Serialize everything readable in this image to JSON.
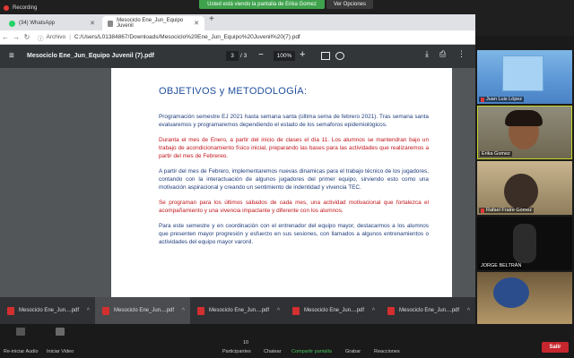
{
  "recording": {
    "label": "Recording"
  },
  "share_banner": {
    "text": "Usted está viendo la pantalla de Erika Gomez",
    "options": "Ver Opciones"
  },
  "browser": {
    "tabs": [
      {
        "label": "(34) WhatsApp",
        "active": false
      },
      {
        "label": "Mesociclo Ene_Jun_Equipo Juvenil",
        "active": true
      }
    ],
    "address": {
      "info": "Archivo",
      "url": "C:/Users/L01384867/Downloads/Mesociclo%20Ene_Jun_Equipo%20Juvenil%20(7).pdf"
    }
  },
  "pdf": {
    "title": "Mesociclo Ene_Jun_Equipo Juvenil (7).pdf",
    "page_current": "3",
    "page_total": "/ 3",
    "zoom": "100%",
    "heading": "OBJETIVOS y METODOLOGÍA:",
    "paragraphs": [
      {
        "text": "Programación semestre EJ 2021 hasta semana santa (última sema de febrero 2021). Tras semana santa evaluaremos y programaremos dependiendo el estado de los semaforos epidemiológicos.",
        "color": "blue"
      },
      {
        "text": "Duranta el mes de Enero, a partir del inicio de clases el día 11. Los alumnos se mantendran bajo un trabajo de acondicionamiento físico inicial, preparando las bases para las actividades que realizaremos a partir del mes de Febrereo.",
        "color": "red"
      },
      {
        "text": "A partir del mes de Febrero, implementaremos nuevas dinamicas para el trabajo técnico de los jugadores, contando con la interactuación de algunos jugadores del primer equipo, sirviendo esto como una motivación aspiracional y creando un sentimiento de indentidad y vivencia TEC.",
        "color": "blue"
      },
      {
        "text": "Se programan para los últimos sábados de cada mes, una actividad motivacional que fortalezca el acompañamiento y una vivencia impactante y diferente con los alumnos.",
        "color": "red"
      },
      {
        "text": "Para este semestre y en coordinación con el entrenador del equipo mayor, destacarmos a los alumnos que presenten mayor progresión y esfuerzo en sus sesiones, con llamados a algunos entrenamientos o actividades del equipo mayor varonil.",
        "color": "blue"
      }
    ]
  },
  "downloads": [
    {
      "label": "Mesociclo Ene_Jun....pdf",
      "highlighted": false
    },
    {
      "label": "Mesociclo Ene_Jun....pdf",
      "highlighted": true
    },
    {
      "label": "Mesociclo Ene_Jun....pdf",
      "highlighted": false
    },
    {
      "label": "Mesociclo Ene_Jun....pdf",
      "highlighted": false
    },
    {
      "label": "Mesociclo Ene_Jun....pdf",
      "highlighted": false
    }
  ],
  "participants": [
    {
      "name": "Juan Luis López"
    },
    {
      "name": "Erika Gomez"
    },
    {
      "name": "Rafael Fraire Gómez"
    },
    {
      "name": "JORGE BELTRÁN"
    },
    {
      "name": ""
    }
  ],
  "controls": {
    "audio": "Re-iniciar Audio",
    "video": "Iniciar Video",
    "participants_count": "10",
    "participants": "Participantes",
    "chat": "Chatear",
    "share": "Compartir pantalla",
    "record": "Grabar",
    "reactions": "Reacciones",
    "leave": "Salir"
  },
  "colors": {
    "share_green": "#3fa34d",
    "leave_red": "#c6262e",
    "pdf_blue": "#1f4e9c",
    "pdf_red": "#c0151c"
  }
}
